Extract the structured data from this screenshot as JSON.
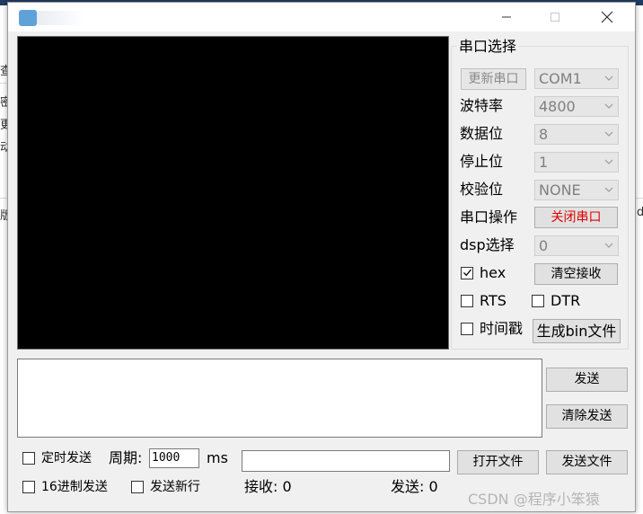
{
  "background_window": {
    "fragments": [
      "查",
      "密",
      "更",
      "动",
      "版",
      "d"
    ]
  },
  "window": {
    "controls": {
      "minimize": "—",
      "maximize": "☐",
      "close": "✕"
    }
  },
  "serial": {
    "group_title": "串口选择",
    "refresh_label": "更新串口",
    "port_value": "COM1",
    "baud_label": "波特率",
    "baud_value": "4800",
    "databits_label": "数据位",
    "databits_value": "8",
    "stopbits_label": "停止位",
    "stopbits_value": "1",
    "parity_label": "校验位",
    "parity_value": "NONE",
    "operation_label": "串口操作",
    "close_port_label": "关闭串口",
    "dsp_label": "dsp选择",
    "dsp_value": "0",
    "hex_label": "hex",
    "hex_checked": true,
    "clear_receive_label": "清空接收",
    "rts_label": "RTS",
    "dtr_label": "DTR",
    "timestamp_label": "时间戳",
    "gen_bin_label": "生成bin文件"
  },
  "send": {
    "send_label": "发送",
    "clear_send_label": "清除发送"
  },
  "bottom": {
    "timed_send_label": "定时发送",
    "period_label": "周期:",
    "period_value": "1000",
    "ms_label": "ms",
    "file_path_value": "",
    "open_file_label": "打开文件",
    "send_file_label": "发送文件",
    "hex_send_label": "16进制发送",
    "send_newline_label": "发送新行",
    "received_label": "接收: 0",
    "sent_label": "发送: 0"
  },
  "watermark": "CSDN @程序小笨猿",
  "colors": {
    "accent_red": "#e00000",
    "receive_area": "#000000",
    "window_bg": "#f0f0f0"
  }
}
